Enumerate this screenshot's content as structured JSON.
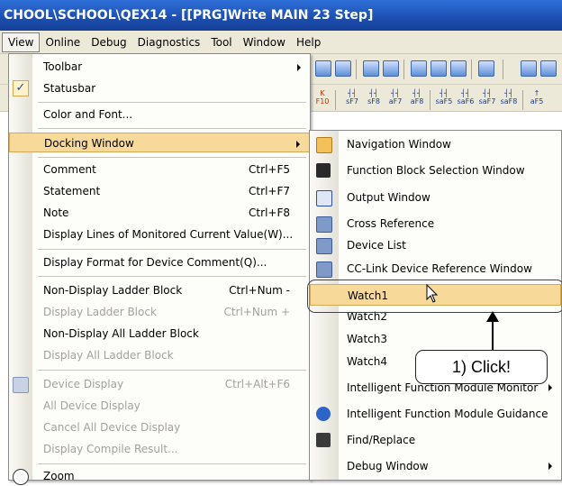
{
  "title": "CHOOL\\SCHOOL\\QEX14 - [[PRG]Write MAIN 23 Step]",
  "menubar": [
    "View",
    "Online",
    "Debug",
    "Diagnostics",
    "Tool",
    "Window",
    "Help"
  ],
  "function_keys": [
    "   K\nF10",
    "   \nsF7",
    "   \nsF8",
    "   \naF7",
    "   \naF8",
    "   \nsaF5",
    "   \nsaF6",
    "   \nsaF7",
    "   \nsaF8",
    "   \naF5"
  ],
  "view_menu": {
    "toolbar": "Toolbar",
    "statusbar": "Statusbar",
    "color_font": "Color and Font...",
    "docking_window": "Docking Window",
    "comment": "Comment",
    "comment_sc": "Ctrl+F5",
    "statement": "Statement",
    "statement_sc": "Ctrl+F7",
    "note": "Note",
    "note_sc": "Ctrl+F8",
    "display_lines": "Display Lines of Monitored Current Value(W)...",
    "display_format": "Display Format for Device Comment(Q)...",
    "non_display_ladder": "Non-Display Ladder Block",
    "non_display_ladder_sc": "Ctrl+Num -",
    "display_ladder": "Display Ladder Block",
    "display_ladder_sc": "Ctrl+Num +",
    "non_display_all": "Non-Display All Ladder Block",
    "display_all": "Display All Ladder Block",
    "device_display": "Device Display",
    "device_display_sc": "Ctrl+Alt+F6",
    "all_device_display": "All Device Display",
    "cancel_all_device": "Cancel All Device Display",
    "display_compile": "Display Compile Result...",
    "zoom": "Zoom"
  },
  "submenu": {
    "navigation": "Navigation Window",
    "fb_selection": "Function Block Selection Window",
    "output": "Output Window",
    "cross_ref": "Cross Reference",
    "device_list": "Device List",
    "cclink": "CC-Link Device Reference Window",
    "watch1": "Watch1",
    "watch2": "Watch2",
    "watch3": "Watch3",
    "watch4": "Watch4",
    "ifm_monitor": "Intelligent Function Module Monitor",
    "ifm_guidance": "Intelligent Function Module Guidance",
    "find_replace": "Find/Replace",
    "debug_window": "Debug Window"
  },
  "callout": "1) Click!",
  "colors": {
    "highlight": "#f7d99a",
    "titlebar": "#1c4fb0"
  }
}
